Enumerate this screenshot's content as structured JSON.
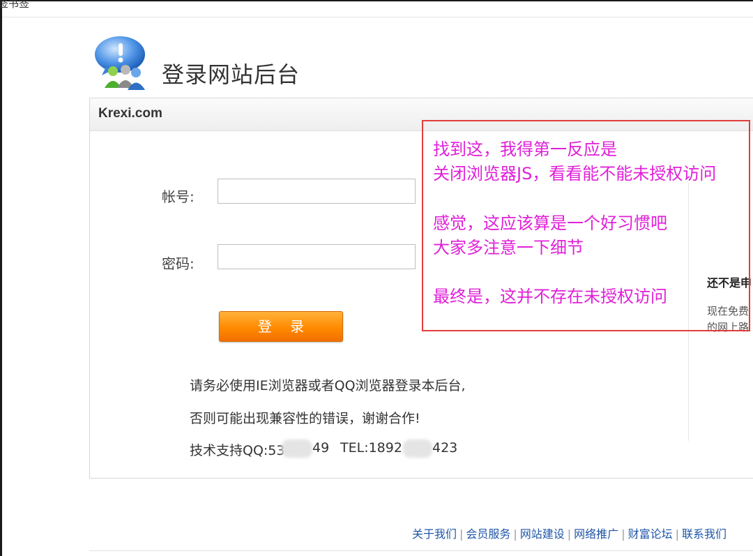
{
  "bookmark_bar": {
    "label": "签书签"
  },
  "header": {
    "title": "登录网站后台"
  },
  "panel": {
    "site_name": "Krexi.com"
  },
  "form": {
    "account_label": "帐号:",
    "account_value": "",
    "password_label": "密码:",
    "password_value": "",
    "login_label": "登 录"
  },
  "notice": {
    "line1": "请务必使用IE浏览器或者QQ浏览器登录本后台,",
    "line2": "否则可能出现兼容性的错误，谢谢合作!",
    "support_prefix": "技术支持QQ:53",
    "support_suffix": "49",
    "tel_prefix": "TEL:1892",
    "tel_suffix": "423"
  },
  "side": {
    "title": "还不是申",
    "text1": "现在免费",
    "text2": "的网上路"
  },
  "annotation": {
    "lines": [
      "找到这，我得第一反应是",
      "关闭浏览器JS，看看能不能未授权访问",
      "感觉，这应该算是一个好习惯吧",
      "大家多注意一下细节",
      "最终是，这并不存在未授权访问"
    ]
  },
  "footer": {
    "links": [
      "关于我们",
      "会员服务",
      "网站建设",
      "网络推广",
      "财富论坛",
      "联系我们"
    ]
  },
  "colors": {
    "annotation_text": "#e020d8",
    "annotation_border": "#e23b3b",
    "button_orange": "#ff8a00",
    "link_blue": "#1f56a8"
  },
  "icons": {
    "logo": "users-group-icon"
  }
}
